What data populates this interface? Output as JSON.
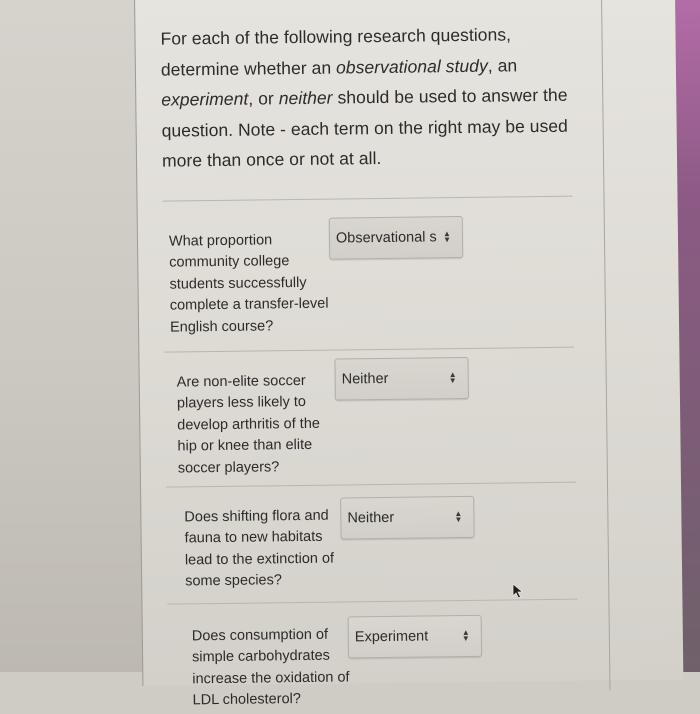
{
  "instructions": {
    "part1": "For each of the following research questions, determine whether an ",
    "term_observational": "observational study",
    "part2": ", an ",
    "term_experiment": "experiment",
    "part3": ", or ",
    "term_neither": "neither",
    "part4": " should be used to answer the question. Note - each term on the right may be used more than once or not at all."
  },
  "questions": [
    {
      "text": "What proportion community college students successfully complete a transfer-level English course?",
      "selected": "Observational s"
    },
    {
      "text": "Are non-elite soccer players less likely to develop arthritis of the hip or knee than elite soccer players?",
      "selected": "Neither"
    },
    {
      "text": "Does shifting flora and fauna to new habitats lead to the extinction of some species?",
      "selected": "Neither"
    },
    {
      "text": "Does consumption of simple carbohydrates increase the oxidation of LDL cholesterol?",
      "selected": "Experiment"
    }
  ],
  "icons": {
    "select_arrows": "up-down-chevron-icon",
    "cursor": "mouse-pointer-icon"
  }
}
